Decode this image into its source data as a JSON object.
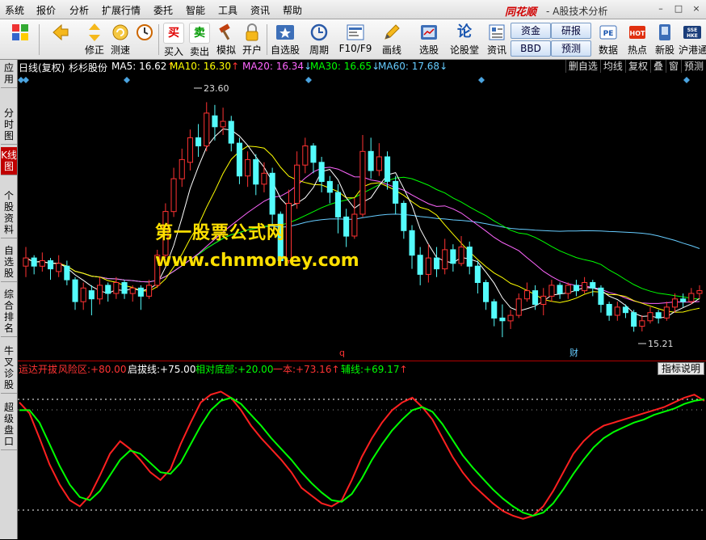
{
  "menu": [
    "系统",
    "报价",
    "分析",
    "扩展行情",
    "委托",
    "智能",
    "工具",
    "资讯",
    "帮助"
  ],
  "brand": "同花顺",
  "window_title": "- A股技术分析",
  "win_controls": [
    "–",
    "□",
    "×"
  ],
  "toolbar": {
    "buttons": [
      {
        "label": "",
        "icon": "grid-icon"
      },
      {
        "label": "",
        "icon": "back-arrow-icon"
      },
      {
        "label": "修正",
        "icon": "up-down-arrow-icon"
      },
      {
        "label": "测速",
        "icon": "refresh-icon"
      },
      {
        "label": "",
        "icon": "clock-icon"
      },
      {
        "label": "买入",
        "glyph": "买"
      },
      {
        "label": "卖出",
        "glyph": "卖"
      },
      {
        "label": "模拟",
        "icon": "hammer-icon"
      },
      {
        "label": "开户",
        "icon": "lock-icon"
      },
      {
        "label": "自选股",
        "icon": "star-icon"
      },
      {
        "label": "周期",
        "icon": "cycle-icon"
      },
      {
        "label": "F10/F9",
        "icon": "f10-icon"
      },
      {
        "label": "画线",
        "icon": "pencil-icon"
      },
      {
        "label": "选股",
        "icon": "select-stock-icon"
      },
      {
        "label": "论股堂",
        "glyph": "论"
      },
      {
        "label": "资讯",
        "icon": "news-icon"
      },
      {
        "label": "数据",
        "icon": "pe-icon"
      },
      {
        "label": "热点",
        "icon": "hot-icon"
      },
      {
        "label": "新股",
        "icon": "new-stock-icon"
      },
      {
        "label": "沪港通",
        "icon": "sse-hkex-icon"
      }
    ],
    "small_buttons": [
      "资金",
      "研报",
      "BBD",
      "预测"
    ]
  },
  "side_tabs": [
    {
      "label": "应用",
      "active": false
    },
    {
      "label": "分时图",
      "active": false
    },
    {
      "label": "K线图",
      "active": true
    },
    {
      "label": "个股资料",
      "active": false
    },
    {
      "label": "自选股",
      "active": false
    },
    {
      "label": "综合排名",
      "active": false
    },
    {
      "label": "牛叉诊股",
      "active": false
    },
    {
      "label": "超级盘口",
      "active": false
    }
  ],
  "main_info": {
    "period": "日线(复权)",
    "stock": "杉杉股份",
    "ma": [
      {
        "name": "MA5:",
        "value": "16.62",
        "arrow": "↑",
        "color": "#ffffff"
      },
      {
        "name": "MA10:",
        "value": "16.30",
        "arrow": "↑",
        "color": "#ffff00"
      },
      {
        "name": "MA20:",
        "value": "16.34",
        "arrow": "↓",
        "color": "#ff66ff"
      },
      {
        "name": "MA30:",
        "value": "16.65",
        "arrow": "↓",
        "color": "#00ff00"
      },
      {
        "name": "MA60:",
        "value": "17.68",
        "arrow": "↓",
        "color": "#66ccff"
      }
    ],
    "period_tabs": [
      "删自选",
      "均线",
      "复权",
      "叠",
      "窗",
      "预测"
    ]
  },
  "chart_annotations": {
    "high": "23.60",
    "low": "15.21",
    "marker_q": "q",
    "marker_cai": "财"
  },
  "watermark": {
    "cn": "第一股票公式网",
    "url": "www.chnmoney.com"
  },
  "indicator_info": {
    "name": "运达开拔",
    "items": [
      {
        "label": "风险区:",
        "value": "+80.00",
        "arrow": "",
        "color": "#ff3333"
      },
      {
        "label": "启拔线:",
        "value": "+75.00",
        "arrow": "",
        "color": "#ffffff"
      },
      {
        "label": "相对底部:",
        "value": "+20.00",
        "arrow": "",
        "color": "#00ff00"
      },
      {
        "label": "一本:",
        "value": "+73.16",
        "arrow": "↑",
        "color": "#ff3333"
      },
      {
        "label": "辅线:",
        "value": "+69.17",
        "arrow": "↑",
        "color": "#00ff00"
      }
    ],
    "help": "指标说明"
  },
  "colors": {
    "up": "#ff3232",
    "down": "#54fcfc",
    "ma5": "#ffffff",
    "ma10": "#ffff00",
    "ma20": "#ff66ff",
    "ma30": "#00ff00",
    "ma60": "#66ccff",
    "line_main": "#ff2020",
    "line_aux": "#00ff00"
  },
  "chart_data": {
    "type": "line",
    "price_range": [
      14.5,
      24.5
    ],
    "candles": [
      {
        "o": 17.6,
        "c": 17.9,
        "h": 18.3,
        "l": 17.2
      },
      {
        "o": 17.9,
        "c": 17.6,
        "h": 18.0,
        "l": 17.3
      },
      {
        "o": 17.6,
        "c": 17.8,
        "h": 18.1,
        "l": 17.4
      },
      {
        "o": 17.8,
        "c": 17.5,
        "h": 17.9,
        "l": 17.1
      },
      {
        "o": 17.4,
        "c": 17.7,
        "h": 18.0,
        "l": 17.2
      },
      {
        "o": 17.6,
        "c": 17.1,
        "h": 17.8,
        "l": 16.9
      },
      {
        "o": 17.1,
        "c": 16.3,
        "h": 17.2,
        "l": 16.0
      },
      {
        "o": 16.3,
        "c": 16.8,
        "h": 17.0,
        "l": 16.0
      },
      {
        "o": 16.7,
        "c": 16.4,
        "h": 16.9,
        "l": 15.8
      },
      {
        "o": 16.4,
        "c": 16.9,
        "h": 17.2,
        "l": 16.2
      },
      {
        "o": 16.9,
        "c": 16.6,
        "h": 17.0,
        "l": 16.3
      },
      {
        "o": 16.6,
        "c": 17.0,
        "h": 17.2,
        "l": 16.4
      },
      {
        "o": 17.0,
        "c": 16.6,
        "h": 17.1,
        "l": 16.4
      },
      {
        "o": 16.6,
        "c": 16.8,
        "h": 16.9,
        "l": 16.3
      },
      {
        "o": 16.8,
        "c": 16.5,
        "h": 16.9,
        "l": 16.0
      },
      {
        "o": 16.5,
        "c": 16.9,
        "h": 17.1,
        "l": 16.4
      },
      {
        "o": 16.9,
        "c": 18.0,
        "h": 18.2,
        "l": 16.8
      },
      {
        "o": 18.0,
        "c": 19.6,
        "h": 19.9,
        "l": 17.9
      },
      {
        "o": 19.6,
        "c": 20.8,
        "h": 21.2,
        "l": 19.4
      },
      {
        "o": 20.8,
        "c": 21.5,
        "h": 21.9,
        "l": 20.5
      },
      {
        "o": 21.4,
        "c": 22.3,
        "h": 22.6,
        "l": 21.1
      },
      {
        "o": 22.3,
        "c": 22.0,
        "h": 22.8,
        "l": 21.6
      },
      {
        "o": 22.0,
        "c": 23.2,
        "h": 23.6,
        "l": 21.8
      },
      {
        "o": 23.1,
        "c": 22.7,
        "h": 23.5,
        "l": 22.2
      },
      {
        "o": 22.7,
        "c": 22.9,
        "h": 23.4,
        "l": 22.4
      },
      {
        "o": 22.9,
        "c": 22.1,
        "h": 23.1,
        "l": 21.8
      },
      {
        "o": 22.1,
        "c": 20.9,
        "h": 22.3,
        "l": 20.6
      },
      {
        "o": 20.9,
        "c": 21.5,
        "h": 21.8,
        "l": 20.5
      },
      {
        "o": 21.5,
        "c": 20.6,
        "h": 21.7,
        "l": 20.2
      },
      {
        "o": 20.6,
        "c": 21.0,
        "h": 21.4,
        "l": 20.3
      },
      {
        "o": 21.0,
        "c": 19.5,
        "h": 21.2,
        "l": 19.1
      },
      {
        "o": 19.5,
        "c": 17.8,
        "h": 19.6,
        "l": 17.6
      },
      {
        "o": 17.8,
        "c": 19.9,
        "h": 20.4,
        "l": 17.7
      },
      {
        "o": 19.9,
        "c": 21.3,
        "h": 21.8,
        "l": 19.7
      },
      {
        "o": 21.3,
        "c": 22.0,
        "h": 22.3,
        "l": 21.0
      },
      {
        "o": 22.0,
        "c": 21.4,
        "h": 22.1,
        "l": 21.0
      },
      {
        "o": 21.4,
        "c": 20.7,
        "h": 21.6,
        "l": 20.3
      },
      {
        "o": 20.7,
        "c": 20.3,
        "h": 20.9,
        "l": 19.9
      },
      {
        "o": 20.3,
        "c": 19.4,
        "h": 20.6,
        "l": 18.8
      },
      {
        "o": 19.4,
        "c": 18.7,
        "h": 19.7,
        "l": 18.3
      },
      {
        "o": 18.7,
        "c": 19.5,
        "h": 20.1,
        "l": 18.6
      },
      {
        "o": 19.5,
        "c": 21.8,
        "h": 22.4,
        "l": 19.4
      },
      {
        "o": 21.8,
        "c": 21.1,
        "h": 22.3,
        "l": 20.8
      },
      {
        "o": 21.1,
        "c": 21.6,
        "h": 22.1,
        "l": 20.9
      },
      {
        "o": 21.6,
        "c": 20.7,
        "h": 21.8,
        "l": 20.4
      },
      {
        "o": 20.7,
        "c": 19.9,
        "h": 20.9,
        "l": 19.5
      },
      {
        "o": 19.9,
        "c": 18.9,
        "h": 20.0,
        "l": 18.6
      },
      {
        "o": 18.9,
        "c": 18.0,
        "h": 19.1,
        "l": 17.5
      },
      {
        "o": 18.0,
        "c": 17.3,
        "h": 18.3,
        "l": 16.9
      },
      {
        "o": 17.3,
        "c": 17.9,
        "h": 18.4,
        "l": 17.0
      },
      {
        "o": 17.9,
        "c": 17.5,
        "h": 18.3,
        "l": 17.2
      },
      {
        "o": 17.5,
        "c": 18.2,
        "h": 18.6,
        "l": 17.3
      },
      {
        "o": 18.2,
        "c": 17.7,
        "h": 18.4,
        "l": 17.4
      },
      {
        "o": 17.7,
        "c": 18.3,
        "h": 18.7,
        "l": 17.6
      },
      {
        "o": 18.3,
        "c": 17.6,
        "h": 18.5,
        "l": 17.3
      },
      {
        "o": 17.6,
        "c": 17.0,
        "h": 17.8,
        "l": 16.6
      },
      {
        "o": 17.0,
        "c": 16.3,
        "h": 17.1,
        "l": 16.0
      },
      {
        "o": 16.3,
        "c": 15.7,
        "h": 16.4,
        "l": 15.4
      },
      {
        "o": 15.7,
        "c": 15.6,
        "h": 16.2,
        "l": 15.0
      },
      {
        "o": 15.6,
        "c": 15.8,
        "h": 16.0,
        "l": 15.3
      },
      {
        "o": 15.8,
        "c": 16.4,
        "h": 16.6,
        "l": 15.7
      },
      {
        "o": 16.4,
        "c": 16.7,
        "h": 17.0,
        "l": 16.3
      },
      {
        "o": 16.7,
        "c": 16.2,
        "h": 16.9,
        "l": 16.0
      },
      {
        "o": 16.2,
        "c": 16.5,
        "h": 16.8,
        "l": 15.8
      },
      {
        "o": 16.5,
        "c": 16.9,
        "h": 17.1,
        "l": 16.3
      },
      {
        "o": 16.9,
        "c": 16.6,
        "h": 17.0,
        "l": 16.4
      },
      {
        "o": 16.6,
        "c": 16.9,
        "h": 17.0,
        "l": 16.4
      },
      {
        "o": 16.9,
        "c": 16.7,
        "h": 17.1,
        "l": 16.5
      },
      {
        "o": 16.7,
        "c": 17.0,
        "h": 17.2,
        "l": 16.6
      },
      {
        "o": 17.0,
        "c": 16.8,
        "h": 17.1,
        "l": 16.5
      },
      {
        "o": 16.8,
        "c": 16.2,
        "h": 16.9,
        "l": 15.9
      },
      {
        "o": 16.2,
        "c": 15.8,
        "h": 16.3,
        "l": 15.6
      },
      {
        "o": 15.8,
        "c": 16.1,
        "h": 16.3,
        "l": 15.6
      },
      {
        "o": 16.1,
        "c": 15.9,
        "h": 16.2,
        "l": 15.7
      },
      {
        "o": 15.9,
        "c": 15.4,
        "h": 16.0,
        "l": 15.2
      },
      {
        "o": 15.4,
        "c": 15.6,
        "h": 15.8,
        "l": 15.21
      },
      {
        "o": 15.6,
        "c": 15.9,
        "h": 16.1,
        "l": 15.5
      },
      {
        "o": 15.9,
        "c": 15.7,
        "h": 16.0,
        "l": 15.5
      },
      {
        "o": 15.7,
        "c": 16.1,
        "h": 16.3,
        "l": 15.6
      },
      {
        "o": 16.1,
        "c": 16.4,
        "h": 16.6,
        "l": 15.9
      },
      {
        "o": 16.4,
        "c": 16.3,
        "h": 16.6,
        "l": 16.1
      },
      {
        "o": 16.3,
        "c": 16.6,
        "h": 16.8,
        "l": 16.2
      },
      {
        "o": 16.6,
        "c": 16.7,
        "h": 16.9,
        "l": 16.4
      }
    ],
    "indicator_range": [
      0,
      100
    ],
    "indicator_main": [
      85,
      78,
      62,
      45,
      32,
      22,
      18,
      25,
      38,
      52,
      60,
      55,
      48,
      40,
      35,
      42,
      58,
      72,
      85,
      90,
      92,
      88,
      80,
      70,
      62,
      55,
      48,
      40,
      30,
      25,
      20,
      18,
      22,
      35,
      50,
      62,
      72,
      80,
      85,
      88,
      82,
      74,
      62,
      50,
      40,
      32,
      26,
      20,
      15,
      12,
      10,
      12,
      18,
      28,
      40,
      52,
      60,
      66,
      70,
      72,
      74,
      76,
      78,
      80,
      82,
      85,
      88,
      90,
      86
    ],
    "indicator_aux": [
      80,
      80,
      72,
      58,
      44,
      32,
      24,
      22,
      28,
      38,
      48,
      54,
      52,
      46,
      40,
      39,
      46,
      58,
      70,
      80,
      86,
      88,
      84,
      77,
      70,
      62,
      55,
      48,
      40,
      33,
      27,
      22,
      21,
      26,
      36,
      48,
      58,
      67,
      74,
      80,
      82,
      79,
      71,
      61,
      51,
      43,
      36,
      29,
      23,
      18,
      14,
      12,
      14,
      20,
      29,
      39,
      48,
      56,
      62,
      66,
      69,
      72,
      74,
      77,
      79,
      81,
      84,
      86,
      87
    ]
  }
}
